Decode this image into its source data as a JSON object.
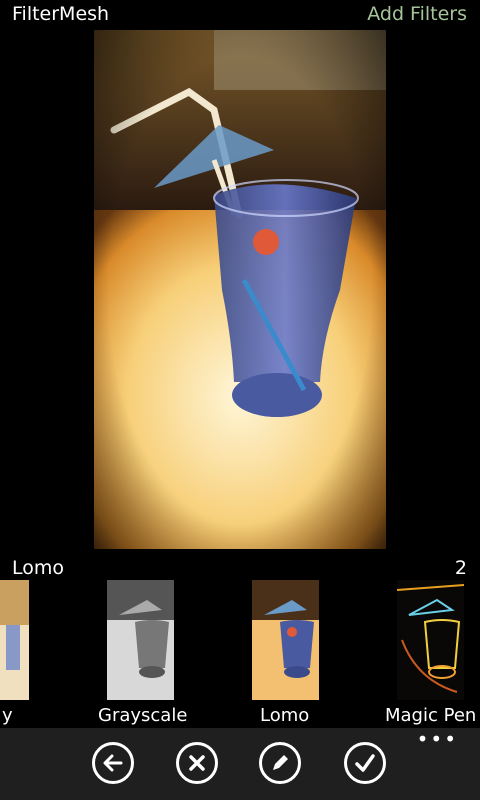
{
  "header": {
    "app_title": "FilterMesh",
    "add_filters_label": "Add Filters"
  },
  "selection": {
    "filter_name": "Lomo",
    "count": "2"
  },
  "filters": [
    {
      "label": "y"
    },
    {
      "label": "Grayscale"
    },
    {
      "label": "Lomo"
    },
    {
      "label": "Magic Pen"
    }
  ],
  "appbar": {
    "buttons": [
      "back-icon",
      "close-icon",
      "edit-icon",
      "check-icon"
    ],
    "more_label": "•••"
  },
  "colors": {
    "accent": "#a6c49a",
    "appbar_bg": "#1f1f1f",
    "background": "#000000"
  }
}
